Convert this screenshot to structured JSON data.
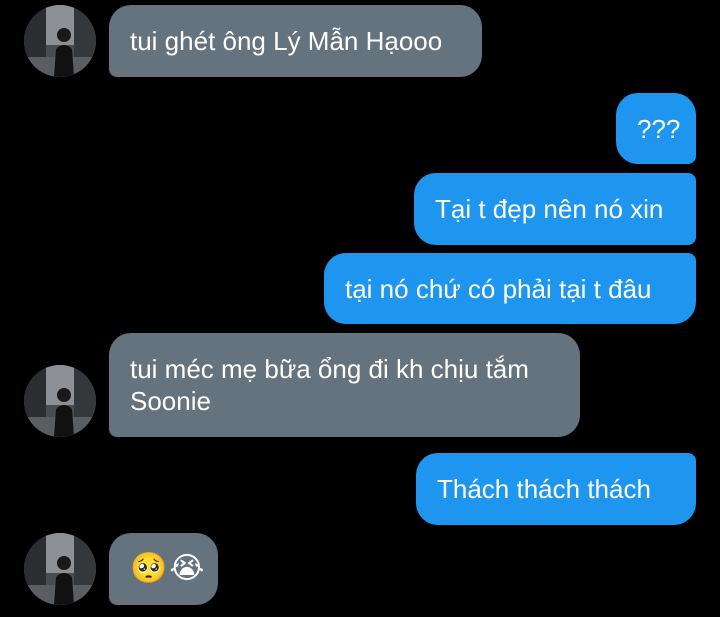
{
  "messages": [
    {
      "from": "contact",
      "text": "tui ghét ông Lý Mẫn Hạooo"
    },
    {
      "from": "me",
      "text": "???"
    },
    {
      "from": "me",
      "text": "Tại t đẹp nên nó xin"
    },
    {
      "from": "me",
      "text": "tại nó chứ có phải tại t đâu"
    },
    {
      "from": "contact",
      "text": "tui méc mẹ bữa ổng đi kh chịu tắm Soonie"
    },
    {
      "from": "me",
      "text": "Thách thách thách"
    },
    {
      "from": "contact",
      "text": "🥺😭"
    }
  ],
  "colors": {
    "background": "#000000",
    "received_bubble": "#65737e",
    "sent_bubble": "#1e96f0",
    "text": "#ffffff"
  },
  "icons": {
    "avatar": "contact-avatar-photo"
  }
}
